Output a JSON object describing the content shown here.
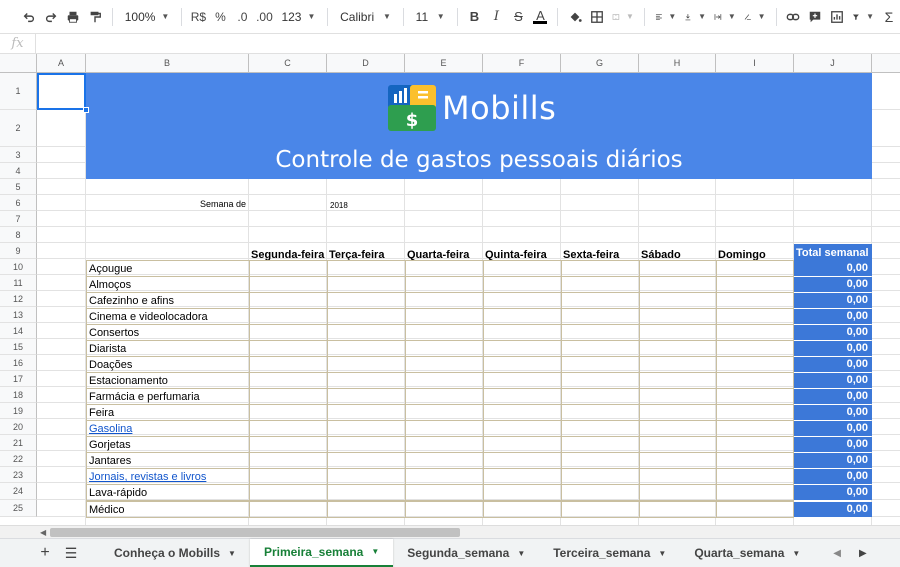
{
  "toolbar": {
    "zoom": "100%",
    "currency": "R$",
    "percent": "%",
    "dec_decrease": ".0",
    "dec_increase": ".00",
    "more_formats": "123",
    "font": "Calibri",
    "font_size": "11"
  },
  "formula_bar": {
    "fx_label": "fx",
    "value": ""
  },
  "columns": [
    "A",
    "B",
    "C",
    "D",
    "E",
    "F",
    "G",
    "H",
    "I",
    "J"
  ],
  "rows": [
    "1",
    "2",
    "3",
    "4",
    "5",
    "6",
    "7",
    "8",
    "9",
    "10",
    "11",
    "12",
    "13",
    "14",
    "15",
    "16",
    "17",
    "18",
    "19",
    "20",
    "21",
    "22",
    "23",
    "24",
    "25"
  ],
  "banner": {
    "brand": "Mobills",
    "subtitle": "Controle de gastos pessoais diários"
  },
  "week": {
    "label": "Semana de",
    "year": "2018"
  },
  "days": [
    "Segunda-feira",
    "Terça-feira",
    "Quarta-feira",
    "Quinta-feira",
    "Sexta-feira",
    "Sábado",
    "Domingo"
  ],
  "total_header": "Total semanal",
  "categories": [
    {
      "name": "Açougue",
      "link": false,
      "total": "0,00"
    },
    {
      "name": "Almoços",
      "link": false,
      "total": "0,00"
    },
    {
      "name": "Cafezinho e afins",
      "link": false,
      "total": "0,00"
    },
    {
      "name": "Cinema e videolocadora",
      "link": false,
      "total": "0,00"
    },
    {
      "name": "Consertos",
      "link": false,
      "total": "0,00"
    },
    {
      "name": "Diarista",
      "link": false,
      "total": "0,00"
    },
    {
      "name": "Doações",
      "link": false,
      "total": "0,00"
    },
    {
      "name": "Estacionamento",
      "link": false,
      "total": "0,00"
    },
    {
      "name": "Farmácia e perfumaria",
      "link": false,
      "total": "0,00"
    },
    {
      "name": "Feira",
      "link": false,
      "total": "0,00"
    },
    {
      "name": "Gasolina",
      "link": true,
      "total": "0,00"
    },
    {
      "name": "Gorjetas",
      "link": false,
      "total": "0,00"
    },
    {
      "name": "Jantares",
      "link": false,
      "total": "0,00"
    },
    {
      "name": "Jornais, revistas e livros",
      "link": true,
      "total": "0,00"
    },
    {
      "name": "Lava-rápido",
      "link": false,
      "total": "0,00"
    },
    {
      "name": "Médico",
      "link": false,
      "total": "0,00"
    }
  ],
  "sheet_tabs": [
    {
      "label": "Conheça o Mobills",
      "active": false
    },
    {
      "label": "Primeira_semana",
      "active": true
    },
    {
      "label": "Segunda_semana",
      "active": false
    },
    {
      "label": "Terceira_semana",
      "active": false
    },
    {
      "label": "Quarta_semana",
      "active": false
    }
  ],
  "colors": {
    "banner": "#4a86e8",
    "total": "#3c78d8",
    "active_tab": "#188038",
    "link": "#1155cc"
  }
}
